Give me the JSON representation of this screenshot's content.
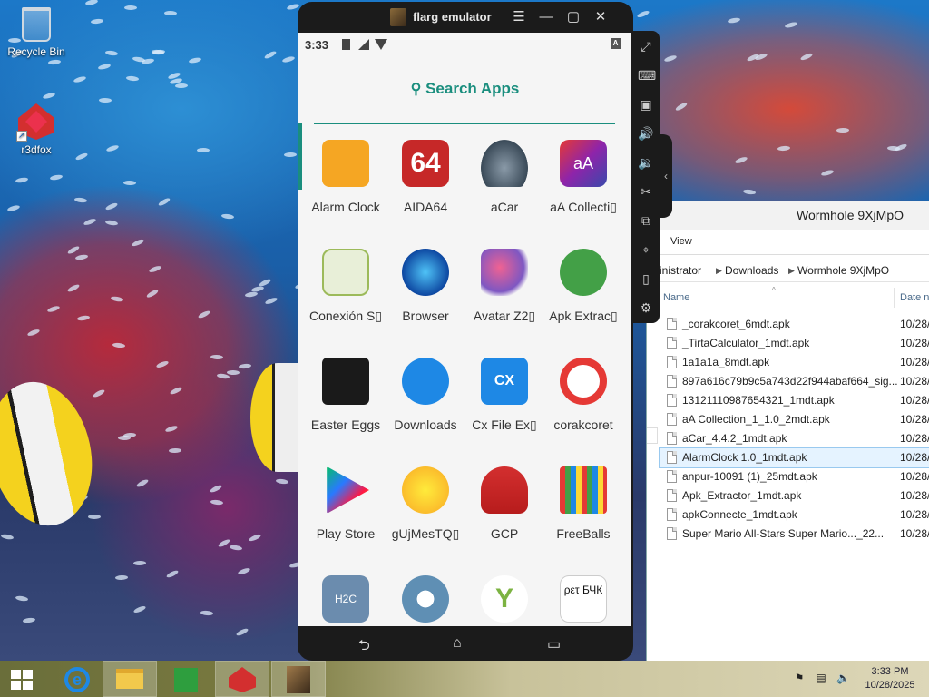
{
  "desktop": {
    "icons": [
      {
        "label": "Recycle Bin",
        "icon": "recycle-bin-icon"
      },
      {
        "label": "r3dfox",
        "icon": "r3dfox-icon"
      }
    ]
  },
  "emulator": {
    "title": "flarg emulator",
    "controls": [
      "menu-icon",
      "minimize-icon",
      "maximize-icon",
      "close-icon"
    ],
    "status_time": "3:33",
    "search_label": "Search Apps",
    "accent_color": "#1a8e7e",
    "apps": [
      {
        "label": "Alarm Clock",
        "icon": "alarm-clock-icon"
      },
      {
        "label": "AIDA64",
        "icon": "aida64-icon",
        "icon_text": "64"
      },
      {
        "label": "aCar",
        "icon": "acar-icon"
      },
      {
        "label": "aA Collecti▯",
        "icon": "aa-collection-icon",
        "icon_text": "aA"
      },
      {
        "label": "Conexión S▯",
        "icon": "conexion-icon"
      },
      {
        "label": "Browser",
        "icon": "browser-icon"
      },
      {
        "label": "Avatar Z2▯",
        "icon": "avatar-z2-icon"
      },
      {
        "label": "Apk Extrac▯",
        "icon": "apk-extractor-icon"
      },
      {
        "label": "Easter Eggs",
        "icon": "easter-eggs-icon"
      },
      {
        "label": "Downloads",
        "icon": "downloads-icon"
      },
      {
        "label": "Cx File Ex▯",
        "icon": "cx-file-explorer-icon",
        "icon_text": "CX"
      },
      {
        "label": "corakcoret",
        "icon": "corakcoret-icon"
      },
      {
        "label": "Play Store",
        "icon": "play-store-icon"
      },
      {
        "label": "gUjMesTQ▯",
        "icon": "smiley-icon"
      },
      {
        "label": "GCP",
        "icon": "gcp-icon"
      },
      {
        "label": "FreeBalls",
        "icon": "freeballs-icon"
      },
      {
        "label": "",
        "icon": "h2c-icon",
        "icon_text": "H2C"
      },
      {
        "label": "",
        "icon": "settings-icon"
      },
      {
        "label": "",
        "icon": "y-app-icon",
        "icon_text": "Y"
      },
      {
        "label": "",
        "icon": "text-app-icon",
        "icon_text": "ρετ БЧК"
      }
    ],
    "side_tools": [
      "fullscreen-icon",
      "keyboard-icon",
      "apk-install-icon",
      "volume-up-icon",
      "volume-down-icon",
      "screenshot-icon",
      "multi-instance-icon",
      "location-icon",
      "shake-icon",
      "settings-icon"
    ]
  },
  "explorer": {
    "title": "Wormhole 9XjMpO",
    "ribbon_tab": "View",
    "breadcrumb": [
      "inistrator",
      "Downloads",
      "Wormhole 9XjMpO"
    ],
    "columns": {
      "name": "Name",
      "date": "Date n"
    },
    "files": [
      {
        "name": "_corakcoret_6mdt.apk",
        "date": "10/28/"
      },
      {
        "name": "_TirtaCalculator_1mdt.apk",
        "date": "10/28/"
      },
      {
        "name": "1a1a1a_8mdt.apk",
        "date": "10/28/"
      },
      {
        "name": "897a616c79b9c5a743d22f944abaf664_sig...",
        "date": "10/28/"
      },
      {
        "name": "13121110987654321_1mdt.apk",
        "date": "10/28/"
      },
      {
        "name": "aA Collection_1_1.0_2mdt.apk",
        "date": "10/28/"
      },
      {
        "name": "aCar_4.4.2_1mdt.apk",
        "date": "10/28/"
      },
      {
        "name": "AlarmClock 1.0_1mdt.apk",
        "date": "10/28/"
      },
      {
        "name": "anpur-10091 (1)_25mdt.apk",
        "date": "10/28/"
      },
      {
        "name": "Apk_Extractor_1mdt.apk",
        "date": "10/28/"
      },
      {
        "name": "apkConnecte_1mdt.apk",
        "date": "10/28/"
      },
      {
        "name": "Super Mario All-Stars  Super Mario..._22...",
        "date": "10/28/"
      }
    ],
    "selected_index": 7
  },
  "taskbar": {
    "time": "3:33 PM",
    "date": "10/28/2025",
    "buttons": [
      "start-icon",
      "internet-explorer-icon",
      "file-explorer-icon",
      "store-icon",
      "r3dfox-icon",
      "emulator-icon"
    ]
  }
}
